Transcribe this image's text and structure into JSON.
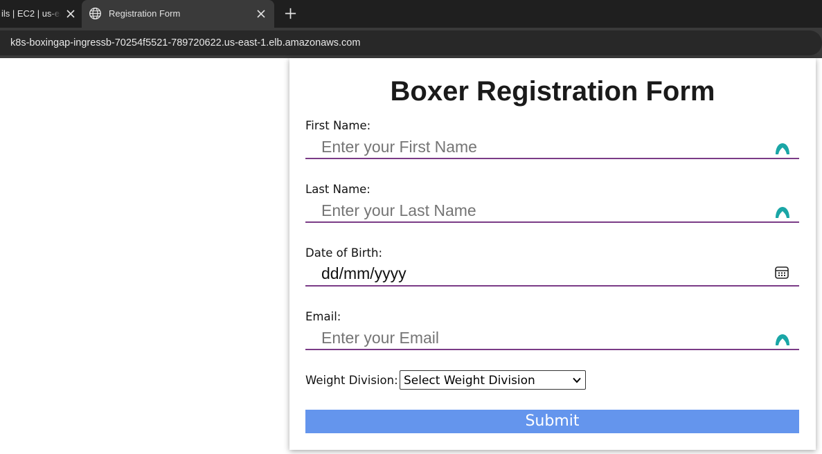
{
  "browser": {
    "tabs": [
      {
        "title": "ils | EC2 | us-ea",
        "active": false
      },
      {
        "title": "Registration Form",
        "active": true
      }
    ],
    "url": "k8s-boxingap-ingressb-70254f5521-789720622.us-east-1.elb.amazonaws.com"
  },
  "form": {
    "title": "Boxer Registration Form",
    "first_name": {
      "label": "First Name:",
      "placeholder": "Enter your First Name"
    },
    "last_name": {
      "label": "Last Name:",
      "placeholder": "Enter your Last Name"
    },
    "dob": {
      "label": "Date of Birth:",
      "value": "dd/mm/yyyy"
    },
    "email": {
      "label": "Email:",
      "placeholder": "Enter your Email"
    },
    "weight_division": {
      "label": "Weight Division:",
      "selected": "Select Weight Division"
    },
    "submit_label": "Submit"
  },
  "colors": {
    "underline": "#7a3b86",
    "submit_bg": "#6495ed",
    "password_manager_icon": "#1aa6a6"
  },
  "icons": {
    "tab_icon": "globe-icon",
    "field_icon": "password-manager-icon",
    "date_icon": "calendar-icon"
  }
}
